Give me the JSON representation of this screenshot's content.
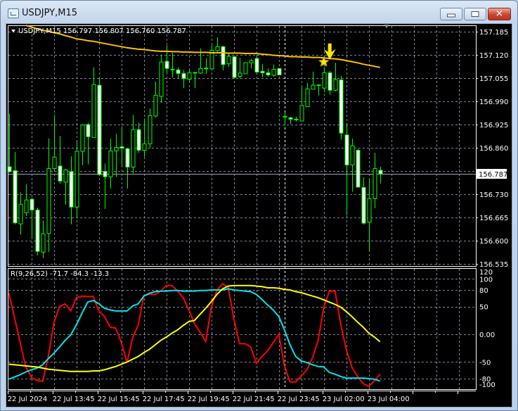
{
  "window": {
    "title": "USDJPY,M15",
    "minimize_label": "",
    "close_glyph": "✕"
  },
  "chart": {
    "header": "USDJPY,M15  156.797 156.807 156.760 156.787",
    "symbol": "USDJPY",
    "timeframe": "M15",
    "current_price": "156.787",
    "price_axis_labels": [
      "157.185",
      "157.120",
      "157.055",
      "156.990",
      "156.925",
      "156.860",
      "156.730",
      "156.665",
      "156.600",
      "156.535"
    ],
    "price_range": [
      156.535,
      157.185
    ],
    "grid_prices": [
      157.185,
      157.12,
      157.055,
      156.99,
      156.925,
      156.86,
      156.795,
      156.73,
      156.665,
      156.6,
      156.535
    ],
    "time_labels": [
      "22 Jul 2024",
      "22 Jul 13:45",
      "22 Jul 15:45",
      "22 Jul 17:45",
      "22 Jul 19:45",
      "22 Jul 21:45",
      "22 Jul 23:45",
      "23 Jul 02:00",
      "23 Jul 04:00"
    ],
    "day_separator_bar": 49,
    "colors": {
      "candle": "#00ff00",
      "bull_fill": "#000000",
      "bear_fill": "#ffffff",
      "ma": "#ffc000",
      "grid": "#7a8699",
      "signal": "#ffe600"
    },
    "candles_ohlc": [
      [
        156.807,
        156.955,
        156.791,
        156.793
      ],
      [
        156.796,
        156.848,
        156.646,
        156.65
      ],
      [
        156.647,
        156.735,
        156.617,
        156.702
      ],
      [
        156.678,
        156.758,
        156.669,
        156.714
      ],
      [
        156.716,
        156.72,
        156.604,
        156.686
      ],
      [
        156.686,
        156.692,
        156.559,
        156.57
      ],
      [
        156.568,
        156.656,
        156.551,
        156.619
      ],
      [
        156.62,
        156.886,
        156.568,
        156.802
      ],
      [
        156.802,
        156.949,
        156.798,
        156.834
      ],
      [
        156.809,
        156.893,
        156.76,
        156.767
      ],
      [
        156.764,
        156.801,
        156.701,
        156.798
      ],
      [
        156.793,
        156.836,
        156.646,
        156.694
      ],
      [
        156.694,
        156.881,
        156.664,
        156.85
      ],
      [
        156.85,
        156.926,
        156.811,
        156.924
      ],
      [
        156.925,
        156.93,
        156.814,
        156.891
      ],
      [
        156.889,
        157.085,
        156.888,
        157.037
      ],
      [
        157.035,
        157.057,
        156.785,
        156.785
      ],
      [
        156.794,
        156.816,
        156.689,
        156.779
      ],
      [
        156.779,
        156.885,
        156.746,
        156.851
      ],
      [
        156.851,
        156.899,
        156.778,
        156.861
      ],
      [
        156.863,
        156.92,
        156.809,
        156.859
      ],
      [
        156.857,
        156.86,
        156.746,
        156.806
      ],
      [
        156.806,
        156.952,
        156.788,
        156.911
      ],
      [
        156.911,
        156.93,
        156.846,
        156.853
      ],
      [
        156.853,
        156.942,
        156.835,
        156.871
      ],
      [
        156.871,
        156.97,
        156.859,
        156.95
      ],
      [
        156.949,
        157.045,
        156.945,
        157.007
      ],
      [
        157.004,
        157.121,
        156.986,
        157.1
      ],
      [
        157.102,
        157.146,
        157.07,
        157.082
      ],
      [
        157.077,
        157.126,
        157.057,
        157.079
      ],
      [
        157.078,
        157.085,
        157.054,
        157.068
      ],
      [
        157.068,
        157.078,
        157.027,
        157.054
      ],
      [
        157.052,
        157.078,
        157.044,
        157.07
      ],
      [
        157.068,
        157.071,
        157.027,
        157.07
      ],
      [
        157.069,
        157.138,
        157.067,
        157.082
      ],
      [
        157.082,
        157.111,
        157.067,
        157.082
      ],
      [
        157.081,
        157.149,
        157.078,
        157.133
      ],
      [
        157.132,
        157.169,
        157.127,
        157.143
      ],
      [
        157.143,
        157.146,
        157.077,
        157.093
      ],
      [
        157.095,
        157.123,
        157.086,
        157.116
      ],
      [
        157.115,
        157.117,
        157.054,
        157.057
      ],
      [
        157.06,
        157.112,
        157.054,
        157.069
      ],
      [
        157.067,
        157.099,
        157.066,
        157.098
      ],
      [
        157.098,
        157.11,
        157.082,
        157.104
      ],
      [
        157.11,
        157.12,
        157.068,
        157.072
      ],
      [
        157.074,
        157.094,
        157.057,
        157.07
      ],
      [
        157.07,
        157.082,
        157.059,
        157.064
      ],
      [
        157.063,
        157.093,
        157.059,
        157.08
      ],
      [
        157.082,
        157.082,
        157.064,
        157.064
      ],
      [
        156.947,
        156.958,
        156.922,
        156.947
      ],
      [
        156.944,
        156.947,
        156.926,
        156.94
      ],
      [
        156.939,
        156.947,
        156.934,
        156.939
      ],
      [
        156.935,
        157.031,
        156.935,
        156.978
      ],
      [
        156.975,
        157.041,
        156.975,
        157.025
      ],
      [
        157.024,
        157.073,
        157.023,
        157.035
      ],
      [
        157.035,
        157.035,
        157.006,
        157.035
      ],
      [
        157.027,
        157.086,
        157.016,
        157.07
      ],
      [
        157.07,
        157.075,
        157.008,
        157.021
      ],
      [
        157.021,
        157.098,
        157.018,
        157.051
      ],
      [
        157.05,
        157.061,
        156.883,
        156.901
      ],
      [
        156.896,
        156.929,
        156.671,
        156.812
      ],
      [
        156.812,
        156.885,
        156.737,
        156.866
      ],
      [
        156.853,
        156.857,
        156.748,
        156.75
      ],
      [
        156.749,
        156.777,
        156.645,
        156.649
      ],
      [
        156.652,
        156.775,
        156.57,
        156.718
      ],
      [
        156.718,
        156.846,
        156.691,
        156.802
      ],
      [
        156.797,
        156.807,
        156.76,
        156.787
      ]
    ],
    "moving_average": [
      null,
      null,
      null,
      157.203,
      157.198,
      157.193,
      157.189,
      157.186,
      157.182,
      157.179,
      157.174,
      157.17,
      157.165,
      157.163,
      157.16,
      157.158,
      157.155,
      157.152,
      157.149,
      157.146,
      157.143,
      157.14,
      157.138,
      157.136,
      157.135,
      157.133,
      157.131,
      157.13,
      157.13,
      157.129,
      157.129,
      157.128,
      157.128,
      157.127,
      157.127,
      157.127,
      157.126,
      157.126,
      157.126,
      157.125,
      157.125,
      157.125,
      157.124,
      157.124,
      157.124,
      157.122,
      157.121,
      157.119,
      157.118,
      157.117,
      157.115,
      157.115,
      157.114,
      157.114,
      157.113,
      157.113,
      157.112,
      157.11,
      157.109,
      157.107,
      157.104,
      157.101,
      157.098,
      157.094,
      157.091,
      157.088,
      157.085
    ],
    "signals": [
      {
        "type": "star",
        "bar": 56,
        "price": 157.1
      },
      {
        "type": "down-arrow",
        "bar": 57,
        "price": 157.152
      }
    ]
  },
  "indicator": {
    "label": "R(9,26,52) -71.7 -84.3 -13.3",
    "axis_labels": [
      "120",
      "100",
      "80",
      "50",
      "0.00",
      "-50",
      "-80",
      "-100"
    ],
    "axis_values": [
      120,
      100,
      80,
      50,
      0,
      -50,
      -80,
      -100
    ],
    "grid_levels": [
      100,
      80,
      50,
      0,
      -50,
      -80
    ],
    "range": [
      -115,
      120
    ],
    "series": [
      {
        "color": "#ff0000",
        "values": [
          74,
          30,
          -15,
          -59,
          -78,
          -83,
          -85,
          -40,
          21,
          50,
          55,
          42,
          66,
          69,
          68,
          68,
          42,
          32,
          13,
          11,
          -15,
          -51,
          -6,
          17,
          70,
          72,
          72,
          78,
          88,
          88,
          78,
          66,
          44,
          19,
          4,
          -13,
          49,
          80,
          91,
          85,
          28,
          -17,
          -17,
          -23,
          -52,
          -40,
          -30,
          -15,
          0,
          -57,
          -86,
          -86,
          -75,
          -64,
          -42,
          -11,
          49,
          78,
          78,
          19,
          -28,
          -59,
          -76,
          -89,
          -94,
          -84,
          -71.7
        ]
      },
      {
        "color": "#00e5ee",
        "values": [
          -81,
          -77,
          -73,
          -68,
          -64,
          -61,
          -55,
          -44,
          -34,
          -23,
          -11,
          -1,
          17,
          38,
          58,
          61,
          55,
          47,
          44,
          42,
          42,
          42,
          51,
          55,
          69,
          74,
          77,
          78,
          78,
          79,
          79,
          78,
          78,
          78,
          79,
          79,
          80,
          80,
          80,
          82,
          80,
          79,
          78,
          77,
          72,
          63,
          53,
          44,
          32,
          8,
          -19,
          -40,
          -48,
          -51,
          -55,
          -58,
          -59,
          -69,
          -72,
          -76,
          -79,
          -79,
          -79,
          -79,
          -80,
          -81,
          -84.3
        ]
      },
      {
        "color": "#ffff00",
        "values": [
          -54,
          -55,
          -56,
          -57,
          -58,
          -59,
          -61,
          -63,
          -64,
          -65,
          -66,
          -67,
          -67,
          -67,
          -67,
          -66,
          -66,
          -64,
          -61,
          -58,
          -54,
          -50,
          -45,
          -40,
          -33,
          -27,
          -19,
          -11,
          -5,
          2,
          8,
          16,
          23,
          25,
          36,
          47,
          59,
          72,
          82,
          87,
          88,
          88,
          88,
          88,
          87,
          86,
          84,
          84,
          83,
          81,
          80,
          77,
          75,
          72,
          69,
          66,
          62,
          58,
          54,
          49,
          41,
          32,
          22,
          13,
          2,
          -5,
          -13.3
        ]
      }
    ]
  }
}
